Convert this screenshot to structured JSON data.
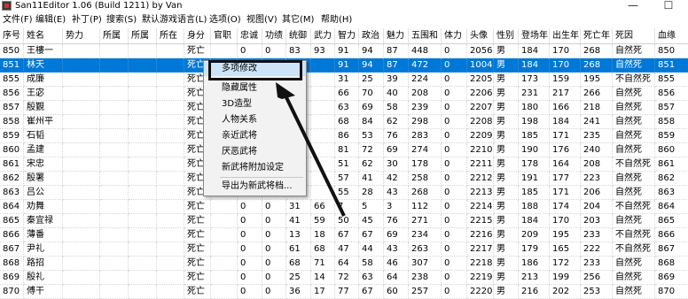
{
  "window": {
    "title": "San11Editor 1.06 (Build 1211) by Van",
    "minimize": "—",
    "maximize": "☐"
  },
  "menu": [
    "文件(F)",
    "编辑(E)",
    "补丁(P)",
    "搜索(S)",
    "默认游戏语言(L)",
    "选项(O)",
    "视图(V)",
    "其它(M)",
    "帮助(H)"
  ],
  "columns": [
    "序号",
    "姓名",
    "势力",
    "所属",
    "所属",
    "所在",
    "身分",
    "官职",
    "忠诚",
    "功绩",
    "统御",
    "武力",
    "智力",
    "政治",
    "魅力",
    "五围和",
    "体力",
    "头像",
    "性别",
    "登场年",
    "出生年",
    "死亡年",
    "死因",
    "血缘"
  ],
  "rows": [
    [
      "850",
      "王樓一",
      "",
      "",
      "",
      "",
      "死亡",
      "",
      "0",
      "0",
      "83",
      "93",
      "91",
      "94",
      "87",
      "448",
      "0",
      "2056",
      "男",
      "184",
      "170",
      "268",
      "自然死",
      "850"
    ],
    [
      "851",
      "林天",
      "",
      "",
      "",
      "",
      "死亡",
      "",
      "",
      "",
      "",
      "",
      "91",
      "94",
      "87",
      "472",
      "0",
      "1004",
      "男",
      "184",
      "170",
      "268",
      "自然死",
      "851"
    ],
    [
      "855",
      "成廉",
      "",
      "",
      "",
      "",
      "死亡",
      "",
      "",
      "",
      "",
      "",
      "31",
      "25",
      "39",
      "224",
      "0",
      "2205",
      "男",
      "173",
      "159",
      "195",
      "不自然死",
      "855"
    ],
    [
      "856",
      "王宓",
      "",
      "",
      "",
      "",
      "死亡",
      "",
      "",
      "",
      "",
      "",
      "66",
      "70",
      "40",
      "208",
      "0",
      "2206",
      "男",
      "231",
      "217",
      "266",
      "自然死",
      "856"
    ],
    [
      "857",
      "殷覲",
      "",
      "",
      "",
      "",
      "死亡",
      "",
      "",
      "",
      "",
      "",
      "63",
      "69",
      "58",
      "239",
      "0",
      "2207",
      "男",
      "180",
      "166",
      "218",
      "自然死",
      "857"
    ],
    [
      "858",
      "崔州平",
      "",
      "",
      "",
      "",
      "死亡",
      "",
      "",
      "",
      "",
      "",
      "68",
      "84",
      "62",
      "298",
      "0",
      "2208",
      "男",
      "198",
      "184",
      "241",
      "自然死",
      "858"
    ],
    [
      "859",
      "石韬",
      "",
      "",
      "",
      "",
      "死亡",
      "",
      "",
      "",
      "",
      "",
      "86",
      "53",
      "76",
      "283",
      "0",
      "2209",
      "男",
      "185",
      "171",
      "235",
      "自然死",
      "859"
    ],
    [
      "860",
      "孟建",
      "",
      "",
      "",
      "",
      "死亡",
      "",
      "",
      "",
      "",
      "",
      "81",
      "72",
      "69",
      "274",
      "0",
      "2210",
      "男",
      "190",
      "176",
      "240",
      "自然死",
      "860"
    ],
    [
      "861",
      "宋忠",
      "",
      "",
      "",
      "",
      "死亡",
      "",
      "",
      "",
      "",
      "",
      "51",
      "62",
      "30",
      "178",
      "0",
      "2211",
      "男",
      "178",
      "164",
      "208",
      "不自然死",
      "861"
    ],
    [
      "862",
      "殷署",
      "",
      "",
      "",
      "",
      "死亡",
      "",
      "",
      "",
      "",
      "",
      "57",
      "41",
      "42",
      "258",
      "0",
      "2212",
      "男",
      "191",
      "177",
      "223",
      "自然死",
      "862"
    ],
    [
      "863",
      "吕公",
      "",
      "",
      "",
      "",
      "死亡",
      "",
      "",
      "",
      "",
      "",
      "55",
      "28",
      "43",
      "268",
      "0",
      "2213",
      "男",
      "185",
      "171",
      "206",
      "自然死",
      "863"
    ],
    [
      "864",
      "劝舞",
      "",
      "",
      "",
      "",
      "死亡",
      "",
      "0",
      "0",
      "31",
      "66",
      "7",
      "5",
      "3",
      "112",
      "0",
      "2214",
      "男",
      "188",
      "174",
      "204",
      "不自然死",
      "864"
    ],
    [
      "865",
      "秦宜禄",
      "",
      "",
      "",
      "",
      "死亡",
      "",
      "0",
      "0",
      "41",
      "59",
      "50",
      "45",
      "76",
      "271",
      "0",
      "2215",
      "男",
      "184",
      "170",
      "203",
      "自然死",
      "865"
    ],
    [
      "866",
      "薄番",
      "",
      "",
      "",
      "",
      "死亡",
      "",
      "0",
      "0",
      "13",
      "18",
      "67",
      "67",
      "69",
      "234",
      "0",
      "2216",
      "男",
      "209",
      "195",
      "233",
      "不自然死",
      "866"
    ],
    [
      "867",
      "尹礼",
      "",
      "",
      "",
      "",
      "死亡",
      "",
      "0",
      "0",
      "61",
      "68",
      "47",
      "44",
      "43",
      "263",
      "0",
      "2217",
      "男",
      "179",
      "165",
      "222",
      "不自然死",
      "867"
    ],
    [
      "868",
      "路招",
      "",
      "",
      "",
      "",
      "死亡",
      "",
      "0",
      "0",
      "68",
      "71",
      "64",
      "58",
      "46",
      "307",
      "0",
      "2218",
      "男",
      "186",
      "172",
      "233",
      "自然死",
      "868"
    ],
    [
      "869",
      "殷礼",
      "",
      "",
      "",
      "",
      "死亡",
      "",
      "0",
      "0",
      "25",
      "14",
      "72",
      "63",
      "64",
      "238",
      "0",
      "2219",
      "男",
      "213",
      "199",
      "256",
      "自然死",
      "869"
    ],
    [
      "870",
      "傅干",
      "",
      "",
      "",
      "",
      "死亡",
      "",
      "0",
      "0",
      "36",
      "17",
      "77",
      "67",
      "60",
      "257",
      "0",
      "2220",
      "男",
      "216",
      "202",
      "253",
      "自然死",
      "870"
    ]
  ],
  "context_menu": {
    "items": [
      "多项修改",
      "隐藏属性",
      "3D造型",
      "人物关系",
      "亲近武将",
      "厌恶武将",
      "新武将附加设定",
      "导出为新武将档..."
    ]
  },
  "colors": {
    "selection": "#0078d7",
    "menu_highlight": "#cce4f7"
  }
}
